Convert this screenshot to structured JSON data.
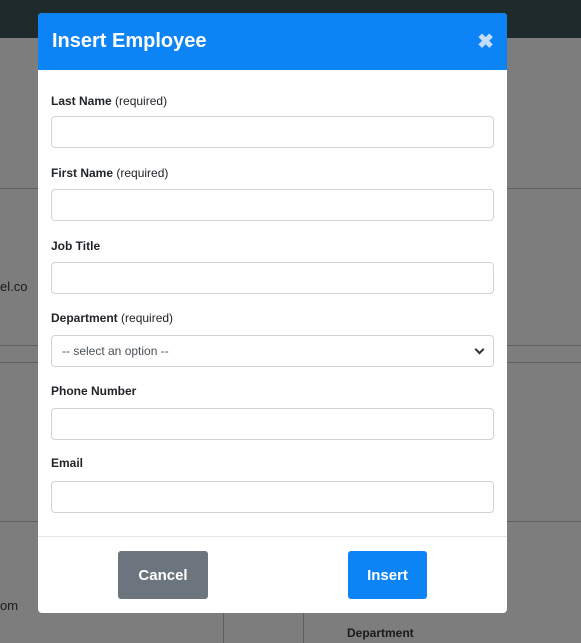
{
  "background": {
    "partial_email_1": "el.co",
    "partial_email_2": "om",
    "column_header": "Department"
  },
  "modal": {
    "title": "Insert Employee",
    "close_glyph": "✖",
    "fields": {
      "last_name": {
        "label": "Last Name",
        "note": "(required)",
        "value": ""
      },
      "first_name": {
        "label": "First Name",
        "note": "(required)",
        "value": ""
      },
      "job_title": {
        "label": "Job Title",
        "value": ""
      },
      "department": {
        "label": "Department",
        "note": "(required)",
        "selected": "-- select an option --"
      },
      "phone": {
        "label": "Phone Number",
        "value": ""
      },
      "email": {
        "label": "Email",
        "value": ""
      }
    },
    "buttons": {
      "cancel": "Cancel",
      "insert": "Insert"
    }
  },
  "colors": {
    "primary": "#0d84f5",
    "secondary": "#6c757d",
    "topbar": "#1e2a2c"
  }
}
